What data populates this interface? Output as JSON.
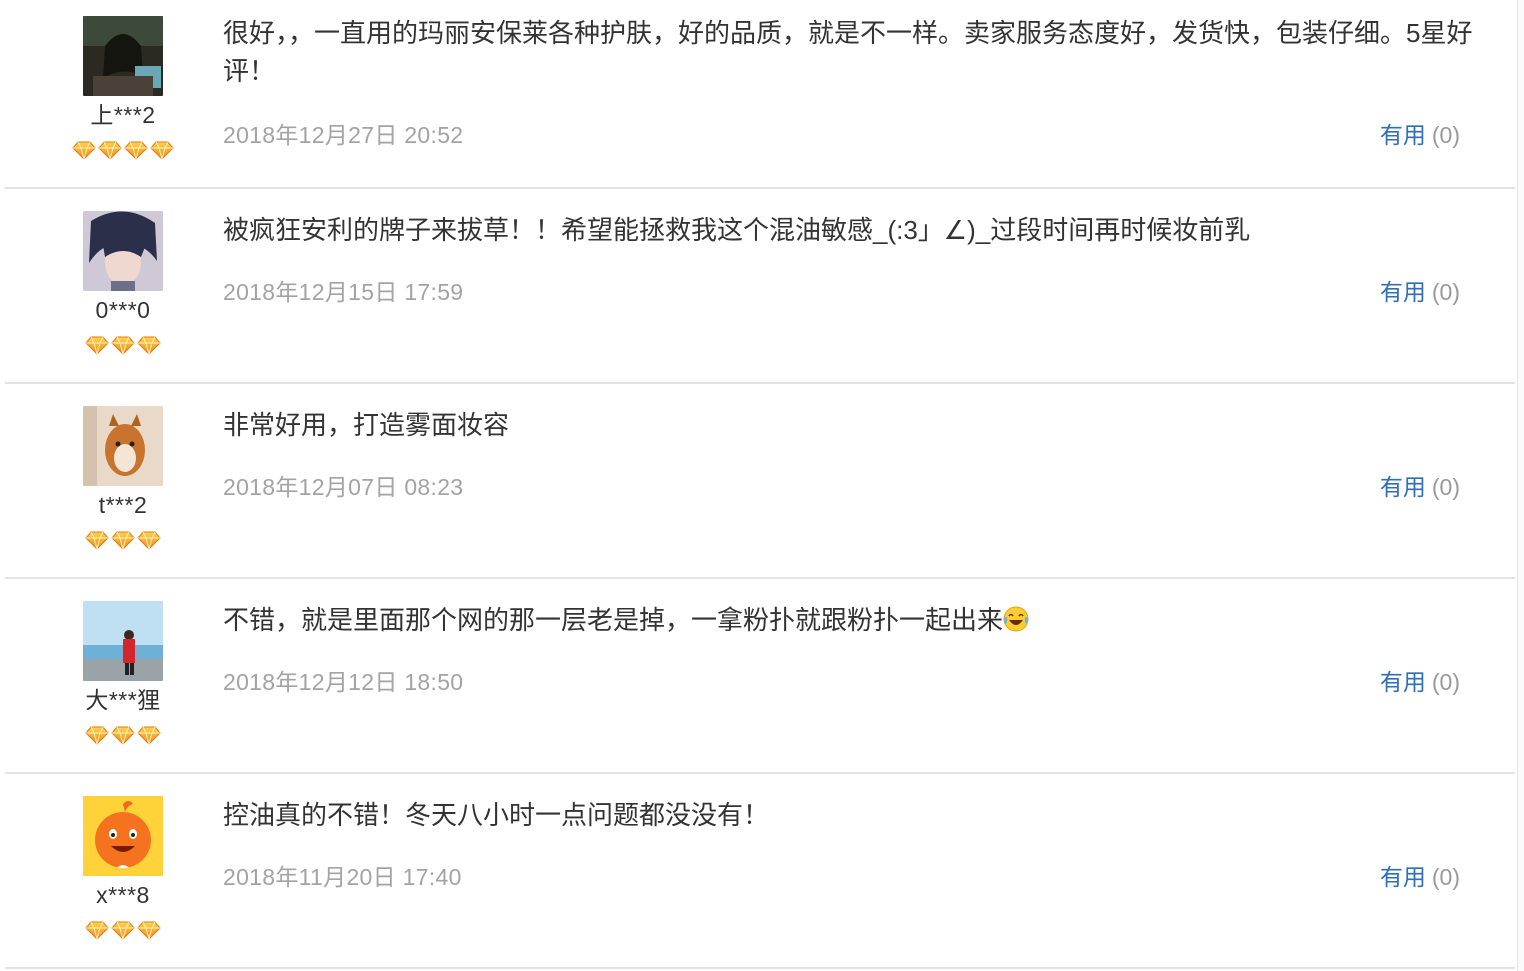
{
  "reviews": [
    {
      "username": "上***2",
      "rank_gems": 4,
      "avatar_icon": "avatar-dark-photo",
      "content": "很好，，一直用的玛丽安保莱各种护肤，好的品质，就是不一样。卖家服务态度好，发货快，包装仔细。5星好评！",
      "date": "2018年12月27日 20:52",
      "useful_label": "有用",
      "useful_count": "(0)"
    },
    {
      "username": "0***0",
      "rank_gems": 3,
      "avatar_icon": "avatar-anime-boy",
      "content": "被疯狂安利的牌子来拔草！！希望能拯救我这个混油敏感_(:3」∠)_过段时间再时候妆前乳",
      "date": "2018年12月15日 17:59",
      "useful_label": "有用",
      "useful_count": "(0)"
    },
    {
      "username": "t***2",
      "rank_gems": 3,
      "avatar_icon": "avatar-dog",
      "content": "非常好用，打造雾面妆容",
      "date": "2018年12月07日 08:23",
      "useful_label": "有用",
      "useful_count": "(0)"
    },
    {
      "username": "大***狸",
      "rank_gems": 3,
      "avatar_icon": "avatar-seaside",
      "content": "不错，就是里面那个网的那一层老是掉，一拿粉扑就跟粉扑一起出来",
      "content_emoji": "laughing-tears-emoji",
      "date": "2018年12月12日 18:50",
      "useful_label": "有用",
      "useful_count": "(0)"
    },
    {
      "username": "x***8",
      "rank_gems": 3,
      "avatar_icon": "avatar-orange-mascot",
      "content": "控油真的不错！冬天八小时一点问题都没没有！",
      "date": "2018年11月20日 17:40",
      "useful_label": "有用",
      "useful_count": "(0)"
    }
  ],
  "colors": {
    "link": "#2e6fb5",
    "date": "#a3a3a3",
    "text": "#333333",
    "gem": "#f5a623",
    "divider": "#e3e3e3"
  }
}
